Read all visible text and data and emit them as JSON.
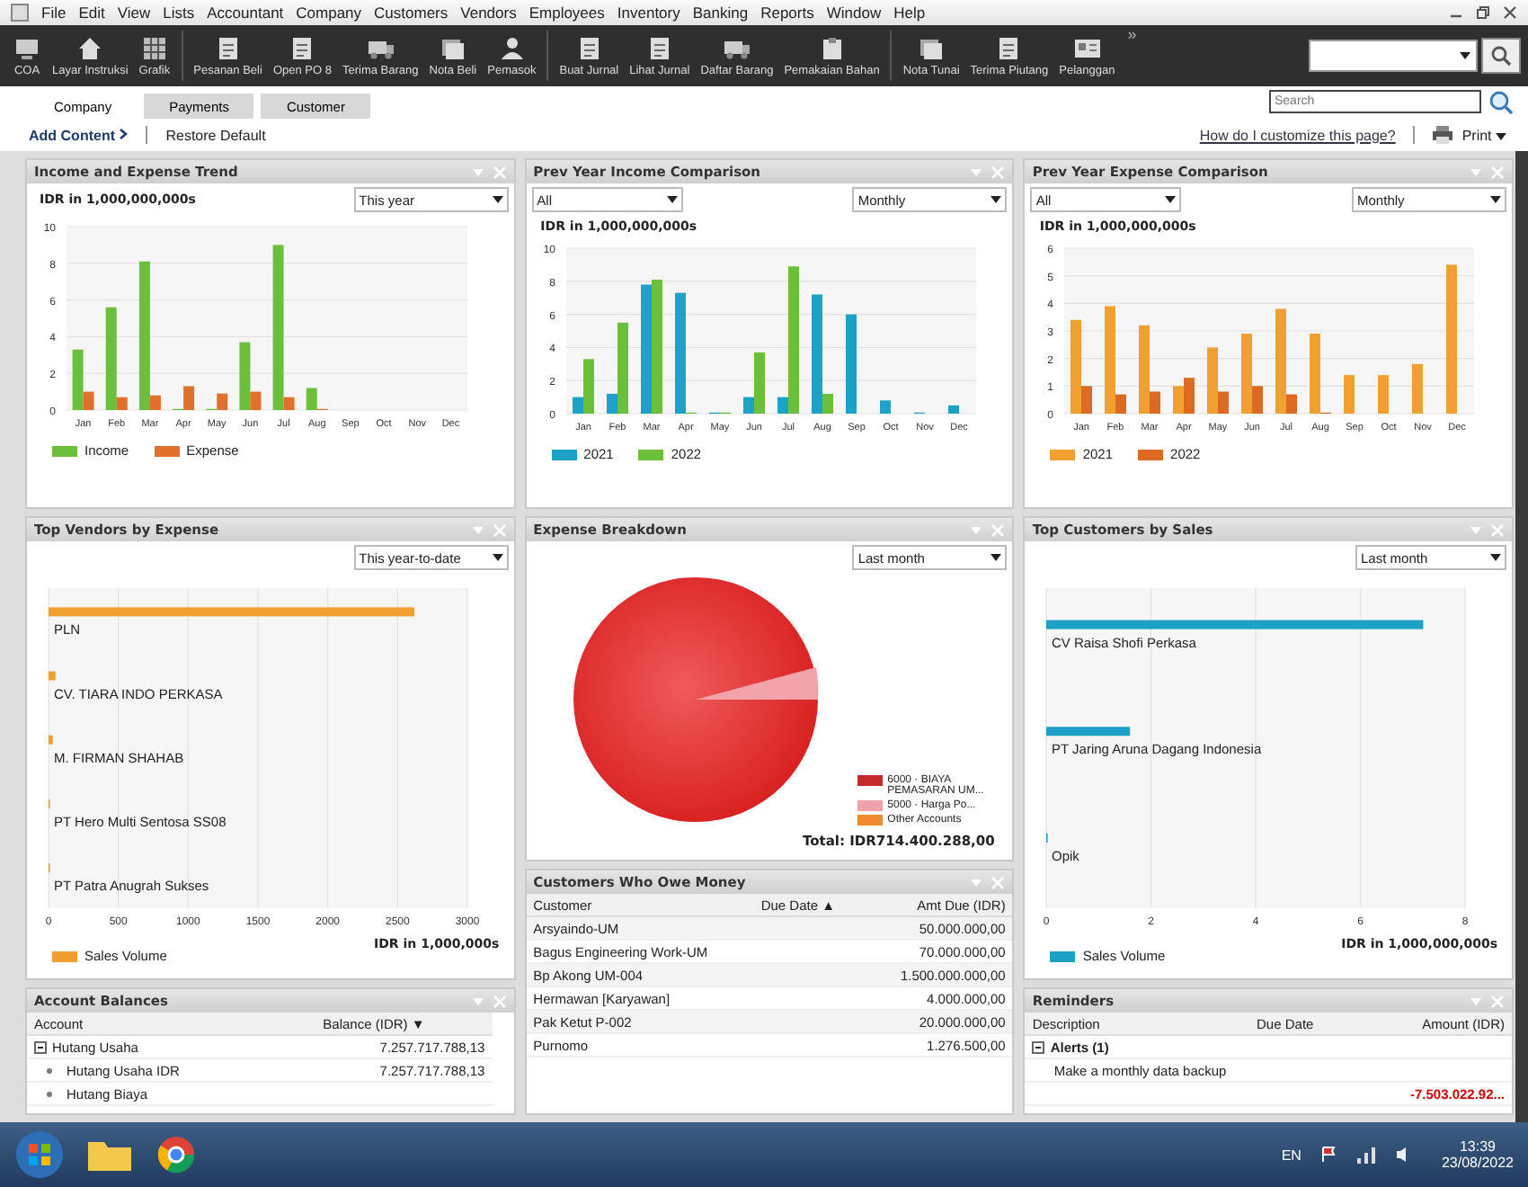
{
  "menu_bar": {
    "items": [
      "File",
      "Edit",
      "View",
      "Lists",
      "Accountant",
      "Company",
      "Customers",
      "Vendors",
      "Employees",
      "Inventory",
      "Banking",
      "Reports",
      "Window",
      "Help"
    ]
  },
  "toolbar": {
    "groups": [
      [
        {
          "label": "COA",
          "kind": "monitor"
        },
        {
          "label": "Layar Instruksi",
          "kind": "house"
        },
        {
          "label": "Grafik",
          "kind": "grid"
        }
      ],
      [
        {
          "label": "Pesanan Beli",
          "kind": "document"
        },
        {
          "label": "Open PO 8",
          "kind": "document"
        },
        {
          "label": "Terima Barang",
          "kind": "truck"
        },
        {
          "label": "Nota Beli",
          "kind": "stack"
        },
        {
          "label": "Pemasok",
          "kind": "person"
        }
      ],
      [
        {
          "label": "Buat Jurnal",
          "kind": "document"
        },
        {
          "label": "Lihat Jurnal",
          "kind": "document"
        },
        {
          "label": "Daftar Barang",
          "kind": "truck"
        },
        {
          "label": "Pemakaian Bahan",
          "kind": "clipboard"
        }
      ],
      [
        {
          "label": "Nota Tunai",
          "kind": "stack"
        },
        {
          "label": "Terima Piutang",
          "kind": "document"
        },
        {
          "label": "Pelanggan",
          "kind": "card"
        }
      ]
    ],
    "more": "»"
  },
  "tabs": [
    {
      "label": "Company",
      "selected": true
    },
    {
      "label": "Payments",
      "selected": false
    },
    {
      "label": "Customer",
      "selected": false
    }
  ],
  "search": {
    "placeholder": "Search"
  },
  "content_bar": {
    "add_content": "Add Content",
    "restore": "Restore Default",
    "help_link": "How do I customize this page?",
    "print": "Print"
  },
  "income_expense_trend": {
    "title": "Income and Expense Trend",
    "period": "This year",
    "chart_data": {
      "type": "bar",
      "ylabel": "IDR in 1,000,000,000s",
      "categories": [
        "Jan",
        "Feb",
        "Mar",
        "Apr",
        "May",
        "Jun",
        "Jul",
        "Aug",
        "Sep",
        "Oct",
        "Nov",
        "Dec"
      ],
      "ylim": [
        0,
        10
      ],
      "yticks": [
        0,
        2,
        4,
        6,
        8,
        10
      ],
      "series": [
        {
          "name": "Income",
          "color": "#6cbf3a",
          "values": [
            3.3,
            5.6,
            8.1,
            0,
            0,
            3.7,
            9.0,
            1.2,
            null,
            null,
            null,
            null
          ]
        },
        {
          "name": "Expense",
          "color": "#e0702a",
          "values": [
            1.0,
            0.7,
            0.8,
            1.3,
            0.9,
            1.0,
            0.7,
            0,
            null,
            null,
            null,
            null
          ]
        }
      ],
      "grid": true
    }
  },
  "prev_year_income": {
    "title": "Prev Year Income Comparison",
    "filter": "All",
    "period": "Monthly",
    "chart_data": {
      "type": "bar",
      "ylabel": "IDR in 1,000,000,000s",
      "categories": [
        "Jan",
        "Feb",
        "Mar",
        "Apr",
        "May",
        "Jun",
        "Jul",
        "Aug",
        "Sep",
        "Oct",
        "Nov",
        "Dec"
      ],
      "ylim": [
        0,
        10
      ],
      "yticks": [
        0,
        2,
        4,
        6,
        8,
        10
      ],
      "series": [
        {
          "name": "2021",
          "color": "#1ea1c6",
          "values": [
            1.0,
            1.2,
            7.8,
            7.3,
            0,
            1.0,
            1.0,
            7.2,
            6.0,
            0.8,
            0,
            0.5
          ]
        },
        {
          "name": "2022",
          "color": "#6cbf3a",
          "values": [
            3.3,
            5.5,
            8.1,
            0,
            0,
            3.7,
            8.9,
            1.2,
            null,
            null,
            null,
            null
          ]
        }
      ],
      "grid": true
    }
  },
  "prev_year_expense": {
    "title": "Prev Year Expense Comparison",
    "filter": "All",
    "period": "Monthly",
    "chart_data": {
      "type": "bar",
      "ylabel": "IDR in 1,000,000,000s",
      "categories": [
        "Jan",
        "Feb",
        "Mar",
        "Apr",
        "May",
        "Jun",
        "Jul",
        "Aug",
        "Sep",
        "Oct",
        "Nov",
        "Dec"
      ],
      "ylim": [
        0,
        6
      ],
      "yticks": [
        0,
        1,
        2,
        3,
        4,
        5,
        6
      ],
      "series": [
        {
          "name": "2021",
          "color": "#f0a030",
          "values": [
            3.4,
            3.9,
            3.2,
            1.0,
            2.4,
            2.9,
            3.8,
            2.9,
            1.4,
            1.4,
            1.8,
            5.4
          ]
        },
        {
          "name": "2022",
          "color": "#dd6a22",
          "values": [
            1.0,
            0.7,
            0.8,
            1.3,
            0.8,
            1.0,
            0.7,
            0,
            null,
            null,
            null,
            null
          ]
        }
      ],
      "grid": true
    }
  },
  "top_vendors": {
    "title": "Top Vendors by Expense",
    "period": "This year-to-date",
    "chart_data": {
      "type": "bar",
      "orientation": "horizontal",
      "xlabel": "IDR in 1,000,000s",
      "categories": [
        "PLN",
        "CV. TIARA INDO PERKASA",
        "M. FIRMAN SHAHAB",
        "PT Hero Multi Sentosa SS08",
        "PT Patra Anugrah Sukses"
      ],
      "xlim": [
        0,
        3000
      ],
      "xticks": [
        0,
        500,
        1000,
        1500,
        2000,
        2500,
        3000
      ],
      "series": [
        {
          "name": "Sales Volume",
          "color": "#f0a030",
          "values": [
            2620,
            50,
            30,
            10,
            0
          ]
        }
      ],
      "grid": true
    }
  },
  "expense_breakdown": {
    "title": "Expense Breakdown",
    "period": "Last month",
    "legend": [
      {
        "label": "6000 · BIAYA PEMASARAN UM...",
        "color": "#c42a2a"
      },
      {
        "label": "5000 · Harga Po...",
        "color": "#f0a0a8"
      },
      {
        "label": "Other Accounts",
        "color": "#ef8a2e"
      }
    ],
    "total": "Total: IDR714.400.288,00"
  },
  "top_customers": {
    "title": "Top Customers by Sales",
    "period": "Last month",
    "chart_data": {
      "type": "bar",
      "orientation": "horizontal",
      "xlabel": "IDR in 1,000,000,000s",
      "categories": [
        "CV Raisa Shofi Perkasa",
        "PT Jaring Aruna Dagang Indonesia",
        "Opik"
      ],
      "xlim": [
        0,
        8
      ],
      "xticks": [
        0,
        2,
        4,
        6,
        8
      ],
      "series": [
        {
          "name": "Sales Volume",
          "color": "#1ea1c6",
          "values": [
            7.2,
            1.6,
            0
          ]
        }
      ],
      "grid": true
    }
  },
  "account_balances": {
    "title": "Account Balances",
    "columns": [
      "Account",
      "Balance (IDR)"
    ],
    "sort_mark": "▼",
    "rows": [
      {
        "account": "Hutang Usaha",
        "balance": "7.257.717.788,13",
        "expanded": true,
        "children": [
          {
            "account": "Hutang Usaha IDR",
            "balance": "7.257.717.788,13"
          },
          {
            "account": "Hutang Biaya"
          }
        ]
      }
    ]
  },
  "customers_owe_money": {
    "title": "Customers Who Owe Money",
    "columns": [
      "Customer",
      "Due Date",
      "Amt Due (IDR)"
    ],
    "sort_mark": "▲",
    "rows": [
      {
        "customer": "Arsyaindo-UM",
        "amount": "50.000.000,00"
      },
      {
        "customer": "Bagus Engineering Work-UM",
        "amount": "70.000.000,00"
      },
      {
        "customer": "Bp Akong UM-004",
        "amount": "1.500.000.000,00"
      },
      {
        "customer": "Hermawan [Karyawan]",
        "amount": "4.000.000,00"
      },
      {
        "customer": "Pak Ketut P-002",
        "amount": "20.000.000,00"
      },
      {
        "customer": "Purnomo",
        "amount": "1.276.500,00"
      }
    ]
  },
  "reminders": {
    "title": "Reminders",
    "columns": [
      "Description",
      "Due Date",
      "Amount (IDR)"
    ],
    "groups": [
      {
        "label": "Alerts (1)",
        "expanded": true,
        "items": [
          {
            "description": "Make a monthly data backup"
          },
          {
            "amount": "-7.503.022.92..."
          }
        ]
      }
    ]
  },
  "taskbar": {
    "language": "EN",
    "time": "13:39",
    "date": "23/08/2022"
  }
}
